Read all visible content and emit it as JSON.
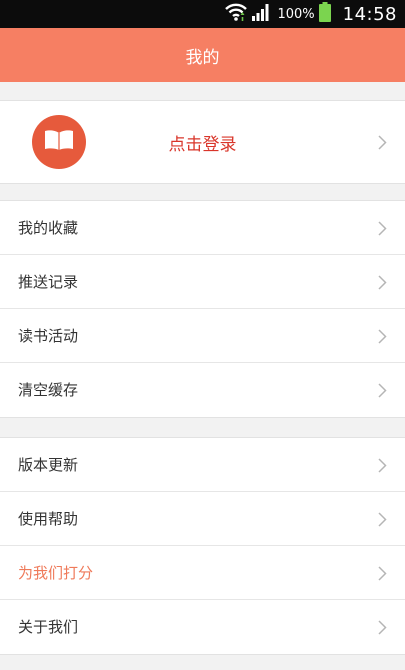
{
  "status_bar": {
    "battery": "100%",
    "time": "14:58"
  },
  "header": {
    "title": "我的"
  },
  "login": {
    "label": "点击登录"
  },
  "groups": [
    {
      "items": [
        {
          "label": "我的收藏"
        },
        {
          "label": "推送记录"
        },
        {
          "label": "读书活动"
        },
        {
          "label": "清空缓存"
        }
      ]
    },
    {
      "items": [
        {
          "label": "版本更新"
        },
        {
          "label": "使用帮助"
        },
        {
          "label": "为我们打分"
        },
        {
          "label": "关于我们"
        }
      ]
    }
  ],
  "colors": {
    "header_bg": "#f67f63",
    "avatar_bg": "#e65a3c",
    "login_text": "#d9352a",
    "accent_item": "#ef7a5a"
  }
}
